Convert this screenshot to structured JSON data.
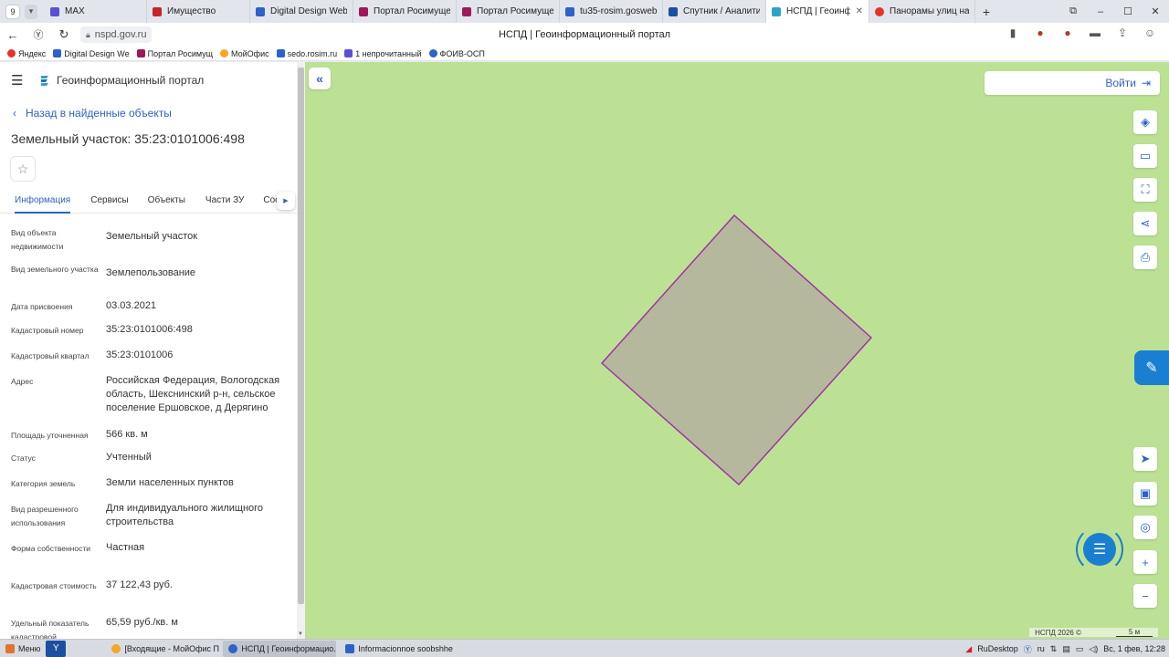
{
  "browser": {
    "tab_count": "9",
    "tabs": [
      {
        "label": "MAX",
        "color": "#5b4fd6"
      },
      {
        "label": "Имущество",
        "color": "#c8222a"
      },
      {
        "label": "Digital Design Web C",
        "color": "#2c62c9"
      },
      {
        "label": "Портал Росимущест",
        "color": "#a0185a"
      },
      {
        "label": "Портал Росимущест",
        "color": "#a0185a"
      },
      {
        "label": "tu35-rosim.gosweb.g",
        "color": "#2c62c9"
      },
      {
        "label": "Спутник / Аналитик",
        "color": "#1b4fa0"
      },
      {
        "label": "НСПД | Геоинфор",
        "color": "#2aa5c9"
      },
      {
        "label": "Панорамы улиц на к",
        "color": "#e5332a"
      }
    ],
    "url": "nspd.gov.ru",
    "page_title": "НСПД | Геоинформационный портал",
    "bookmarks": [
      {
        "label": "Яндекс",
        "color": "#e5332a"
      },
      {
        "label": "Digital Design We",
        "color": "#2c62c9"
      },
      {
        "label": "Портал Росимущ",
        "color": "#a0185a"
      },
      {
        "label": "МойОфис",
        "color": "#f5a623"
      },
      {
        "label": "sedo.rosim.ru",
        "color": "#2c62c9"
      },
      {
        "label": "1 непрочитанный",
        "color": "#5b4fd6"
      },
      {
        "label": "ФОИВ-ОСП",
        "color": "#2c62c9"
      }
    ]
  },
  "panel": {
    "app_title": "Геоинформационный портал",
    "back_link": "Назад в найденные объекты",
    "object_title": "Земельный участок: 35:23:0101006:498",
    "tabs": [
      "Информация",
      "Сервисы",
      "Объекты",
      "Части ЗУ",
      "Состав"
    ],
    "fields": [
      {
        "label": "Вид объекта недвижимости",
        "value": "Земельный участок"
      },
      {
        "label": "Вид земельного участка",
        "value": "Землепользование"
      },
      {
        "label": "Дата присвоения",
        "value": "03.03.2021"
      },
      {
        "label": "Кадастровый номер",
        "value": "35:23:0101006:498"
      },
      {
        "label": "Кадастровый квартал",
        "value": "35:23:0101006"
      },
      {
        "label": "Адрес",
        "value": "Российская Федерация, Вологодская область, Шекснинский р-н, сельское поселение Ершовское, д Дерягино"
      },
      {
        "label": "Площадь уточненная",
        "value": "566 кв. м"
      },
      {
        "label": "Статус",
        "value": "Учтенный"
      },
      {
        "label": "Категория земель",
        "value": "Земли населенных пунктов"
      },
      {
        "label": "Вид разрешенного использования",
        "value": "Для индивидуального жилищного строительства"
      },
      {
        "label": "Форма собственности",
        "value": "Частная"
      },
      {
        "label": "Кадастровая стоимость",
        "value": "37 122,43 руб."
      },
      {
        "label": "Удельный показатель кадастровой",
        "value": "65,59 руб./кв. м"
      }
    ]
  },
  "map": {
    "login_label": "Войти",
    "attribution": "НСПД 2026 ©",
    "scale_label": "5 м",
    "colors": {
      "background": "#bce194",
      "parcel_fill": "#b5b89c",
      "parcel_stroke": "#a02aa8",
      "accent": "#2c62c9"
    }
  },
  "taskbar": {
    "start_label": "Меню",
    "tasks": [
      {
        "label": "[Входящие - МойОфис П...",
        "color": "#f5a623"
      },
      {
        "label": "НСПД | Геоинформацио...",
        "color": "#2c62c9"
      },
      {
        "label": "Informacionnoe soobshhe...",
        "color": "#2c62c9"
      }
    ],
    "tray_app": "RuDesktop",
    "lang": "ru",
    "clock": "Вс, 1 фев, 12:28"
  }
}
